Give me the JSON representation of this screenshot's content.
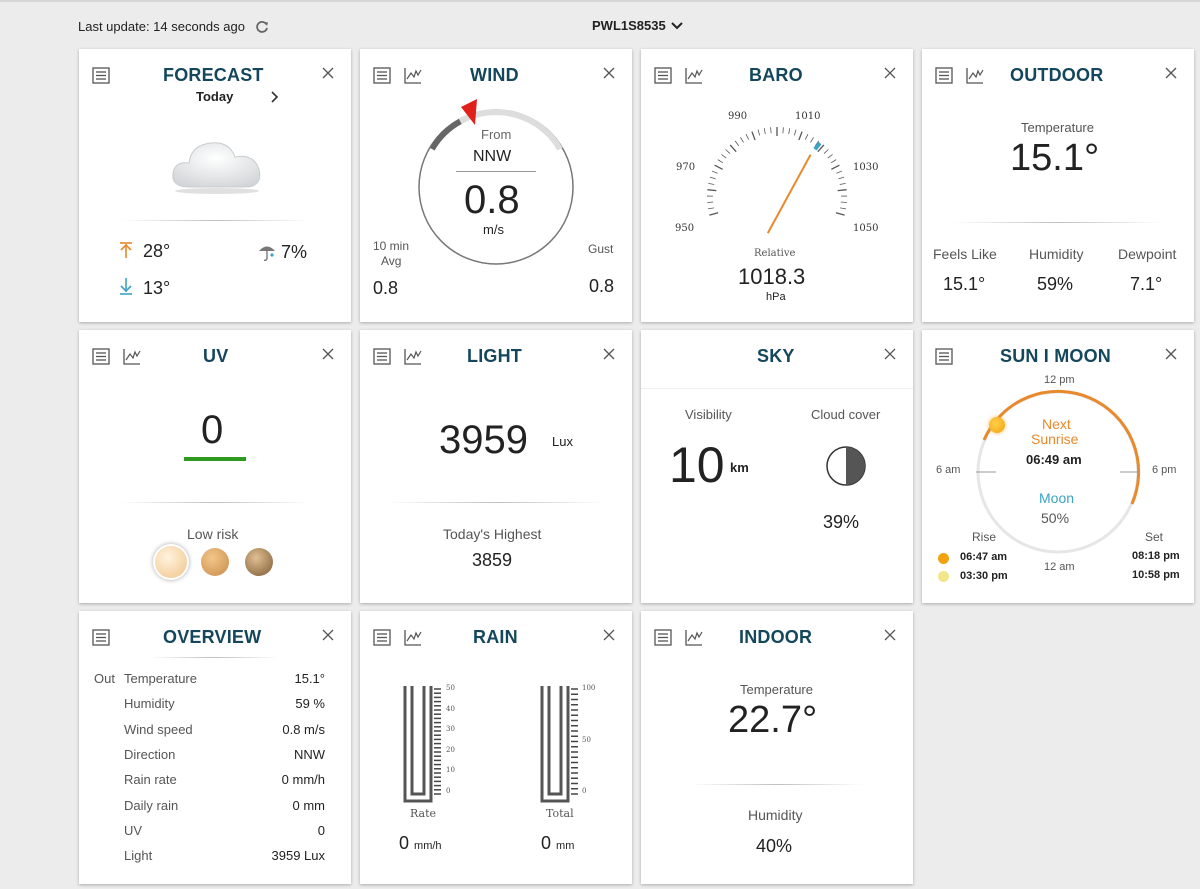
{
  "header": {
    "last_update": "Last update: 14 seconds ago",
    "station": "PWL1S8535"
  },
  "forecast": {
    "title": "FORECAST",
    "day": "Today",
    "high": "28°",
    "low": "13°",
    "precip": "7%"
  },
  "wind": {
    "title": "WIND",
    "from_label": "From",
    "direction": "NNW",
    "speed": "0.8",
    "unit": "m/s",
    "avg_label1": "10 min",
    "avg_label2": "Avg",
    "avg_value": "0.8",
    "gust_label": "Gust",
    "gust_value": "0.8",
    "direction_degrees": 337.5
  },
  "baro": {
    "title": "BARO",
    "ticks": {
      "t990": "990",
      "t1010": "1010",
      "t970": "970",
      "t1030": "1030",
      "t950": "950",
      "t1050": "1050"
    },
    "relative_label": "Relative",
    "value": "1018.3",
    "unit": "hPa",
    "value_num": 1018.3
  },
  "outdoor": {
    "title": "OUTDOOR",
    "temp_label": "Temperature",
    "temp": "15.1°",
    "feels_label": "Feels Like",
    "feels": "15.1°",
    "humidity_label": "Humidity",
    "humidity": "59%",
    "dewpoint_label": "Dewpoint",
    "dewpoint": "7.1°"
  },
  "uv": {
    "title": "UV",
    "value": "0",
    "risk": "Low risk"
  },
  "light": {
    "title": "LIGHT",
    "value": "3959",
    "unit": "Lux",
    "highest_label": "Today's Highest",
    "highest": "3859"
  },
  "sky": {
    "title": "SKY",
    "visibility_label": "Visibility",
    "visibility": "10",
    "visibility_unit": "km",
    "cloud_label": "Cloud cover",
    "cloud": "39%"
  },
  "sunmoon": {
    "title": "SUN I MOON",
    "noon_top": "12 pm",
    "am6": "6 am",
    "pm6": "6 pm",
    "next_label1": "Next",
    "next_label2": "Sunrise",
    "next_time": "06:49 am",
    "moon_label": "Moon",
    "moon_pct": "50%",
    "rise_label": "Rise",
    "set_label": "Set",
    "midnight": "12 am",
    "sun_rise": "06:47 am",
    "sun_set": "08:18 pm",
    "moon_rise": "03:30 pm",
    "moon_set": "10:58 pm"
  },
  "overview": {
    "title": "OVERVIEW",
    "out_label": "Out",
    "rows": [
      {
        "label": "Temperature",
        "value": "15.1°"
      },
      {
        "label": "Humidity",
        "value": "59 %"
      },
      {
        "label": "Wind speed",
        "value": "0.8 m/s"
      },
      {
        "label": "Direction",
        "value": "NNW"
      },
      {
        "label": "Rain rate",
        "value": "0 mm/h"
      },
      {
        "label": "Daily rain",
        "value": "0 mm"
      },
      {
        "label": "UV",
        "value": "0"
      },
      {
        "label": "Light",
        "value": "3959 Lux"
      }
    ]
  },
  "rain": {
    "title": "RAIN",
    "rate_ticks": [
      "50",
      "40",
      "30",
      "20",
      "10",
      "0"
    ],
    "total_ticks": [
      "100",
      "50",
      "0"
    ],
    "rate_label": "Rate",
    "total_label": "Total",
    "rate_value": "0",
    "rate_unit": "mm/h",
    "total_value": "0",
    "total_unit": "mm"
  },
  "indoor": {
    "title": "INDOOR",
    "temp_label": "Temperature",
    "temp": "22.7°",
    "humidity_label": "Humidity",
    "humidity": "40%"
  },
  "colors": {
    "title": "#14475c",
    "accent_orange": "#e8892b",
    "accent_blue": "#3aa3c4",
    "uv_green": "#2e9a1f",
    "wind_pointer": "#e0201a"
  }
}
